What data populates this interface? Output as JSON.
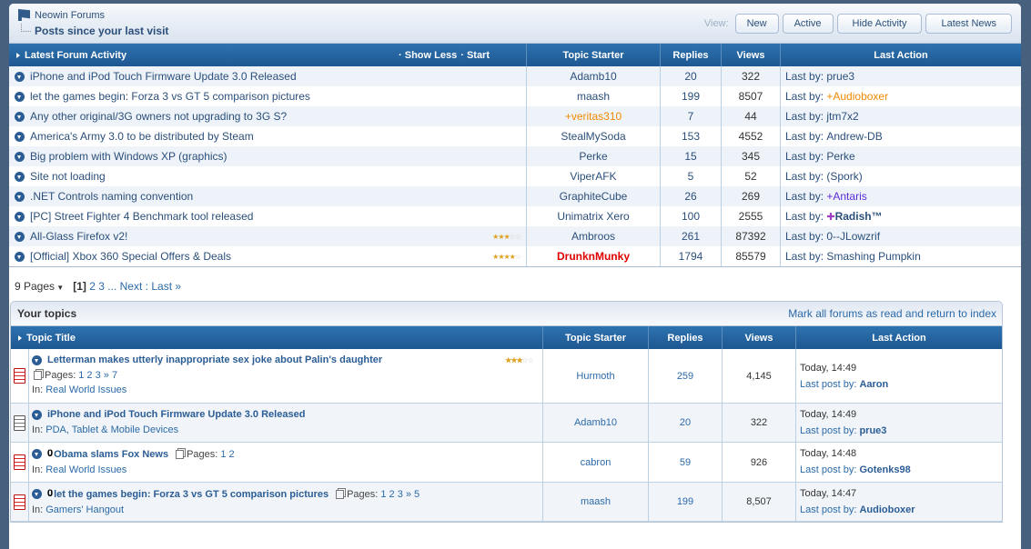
{
  "header": {
    "breadcrumb": "Neowin Forums",
    "title": "Posts since your last visit",
    "view_label": "View:",
    "buttons": [
      "New",
      "Active",
      "Hide Activity",
      "Latest News"
    ]
  },
  "latest": {
    "title": "Latest Forum Activity",
    "show_less": "· Show Less",
    "start": "· Start",
    "columns": [
      "Topic Starter",
      "Replies",
      "Views",
      "Last Action"
    ],
    "rows": [
      {
        "title": "iPhone and iPod Touch Firmware Update 3.0 Released",
        "starter": "Adamb10",
        "replies": "20",
        "views": "322",
        "last_prefix": "Last by:",
        "last": "prue3"
      },
      {
        "title": "let the games begin: Forza 3 vs GT 5 comparison pictures",
        "starter": "maash",
        "replies": "199",
        "views": "8507",
        "last_prefix": "Last by:",
        "last": "+Audioboxer"
      },
      {
        "title": "Any other original/3G owners not upgrading to 3G S?",
        "starter": "+veritas310",
        "replies": "7",
        "views": "44",
        "last_prefix": "Last by:",
        "last": "jtm7x2"
      },
      {
        "title": "America's Army 3.0 to be distributed by Steam",
        "starter": "StealMySoda",
        "replies": "153",
        "views": "4552",
        "last_prefix": "Last by:",
        "last": "Andrew-DB"
      },
      {
        "title": "Big problem with Windows XP (graphics)",
        "starter": "Perke",
        "replies": "15",
        "views": "345",
        "last_prefix": "Last by:",
        "last": "Perke"
      },
      {
        "title": "Site not loading",
        "starter": "ViperAFK",
        "replies": "5",
        "views": "52",
        "last_prefix": "Last by:",
        "last": "(Spork)"
      },
      {
        "title": ".NET Controls naming convention",
        "starter": "GraphiteCube",
        "replies": "26",
        "views": "269",
        "last_prefix": "Last by:",
        "last": "+Antaris"
      },
      {
        "title": "[PC] Street Fighter 4 Benchmark tool released",
        "starter": "Unimatrix Xero",
        "replies": "100",
        "views": "2555",
        "last_prefix": "Last by:",
        "last": "Radish™"
      },
      {
        "title": "All-Glass Firefox v2!",
        "starter": "Ambroos",
        "replies": "261",
        "views": "87392",
        "last_prefix": "Last by:",
        "last": "0--JLowzrif",
        "rating": 3
      },
      {
        "title": "[Official] Xbox 360 Special Offers & Deals",
        "starter": "DrunknMunky",
        "replies": "1794",
        "views": "85579",
        "last_prefix": "Last by:",
        "last": "Smashing Pumpkin",
        "rating": 4
      }
    ]
  },
  "pagination": {
    "pages": "9 Pages",
    "current": "[1]",
    "links": [
      "2",
      "3"
    ],
    "ellipsis": "...",
    "next": "Next",
    "sep": ":",
    "last": "Last »"
  },
  "your_topics": {
    "title": "Your topics",
    "mark_read": "Mark all forums as read and return to index",
    "columns": [
      "Topic Title",
      "Topic Starter",
      "Replies",
      "Views",
      "Last Action"
    ],
    "rows": [
      {
        "title": "Letterman makes utterly inappropriate sex joke about Palin's daughter",
        "pages_label": "Pages:",
        "pages": "1 2 3 » 7",
        "forum_prefix": "In:",
        "forum": "Real World Issues",
        "starter": "Hurmoth",
        "replies": "259",
        "views": "4,145",
        "date": "Today, 14:49",
        "last_prefix": "Last post by:",
        "last": "Aaron",
        "rating": 3,
        "hot": true
      },
      {
        "title": "iPhone and iPod Touch Firmware Update 3.0 Released",
        "forum_prefix": "In:",
        "forum": "PDA, Tablet & Mobile Devices",
        "starter": "Adamb10",
        "replies": "20",
        "views": "322",
        "date": "Today, 14:49",
        "last_prefix": "Last post by:",
        "last": "prue3",
        "hot": false
      },
      {
        "title": "Obama slams Fox News",
        "pages_label": "Pages:",
        "pages": "1 2",
        "forum_prefix": "In:",
        "forum": "Real World Issues",
        "starter": "cabron",
        "replies": "59",
        "views": "926",
        "date": "Today, 14:48",
        "last_prefix": "Last post by:",
        "last": "Gotenks98",
        "hot": true,
        "attach": true
      },
      {
        "title": "let the games begin: Forza 3 vs GT 5 comparison pictures",
        "pages_label": "Pages:",
        "pages": "1 2 3 » 5",
        "forum_prefix": "In:",
        "forum": "Gamers' Hangout",
        "starter": "maash",
        "replies": "199",
        "views": "8,507",
        "date": "Today, 14:47",
        "last_prefix": "Last post by:",
        "last": "Audioboxer",
        "hot": true,
        "attach": true
      }
    ]
  },
  "colors": {
    "bar": "#1e5791",
    "orange": "#f08a00",
    "red": "#e00000",
    "purple": "#5b2bd6"
  }
}
